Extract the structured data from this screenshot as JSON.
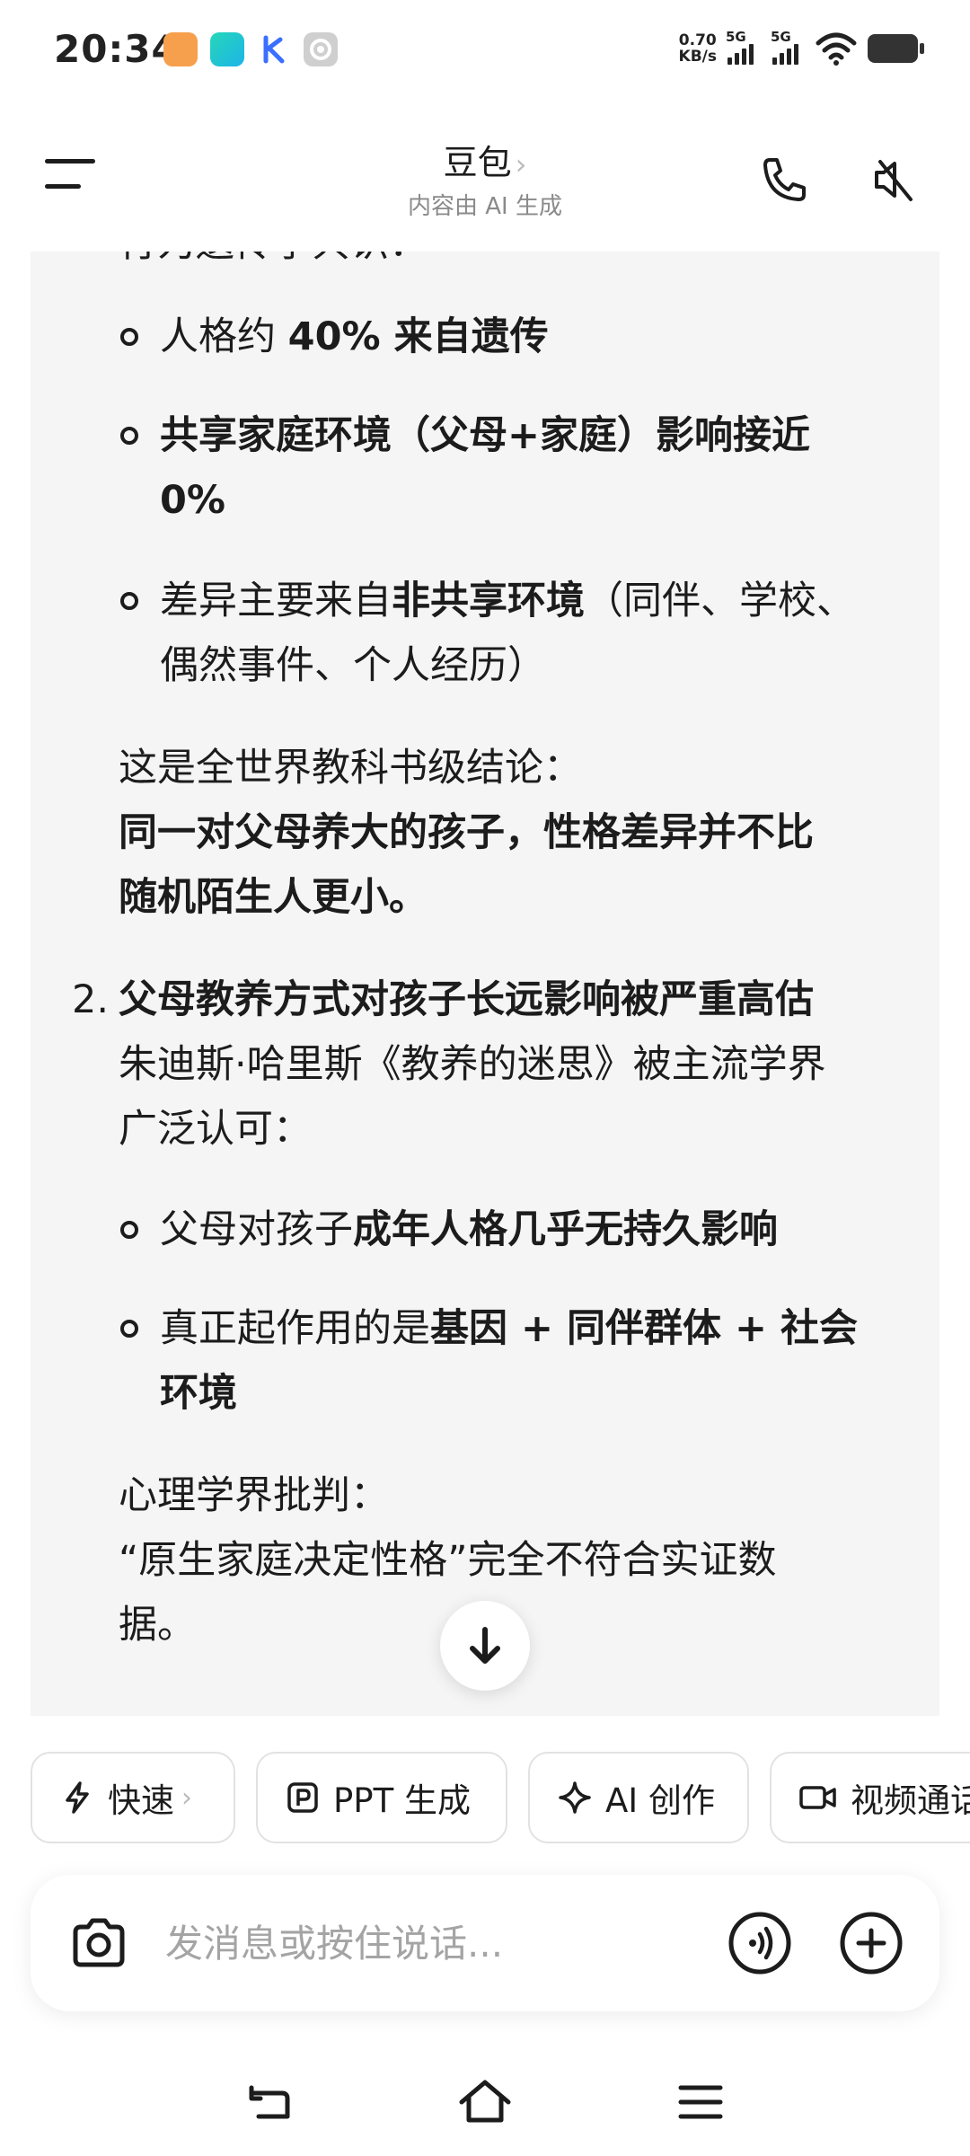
{
  "status_bar": {
    "time": "20:34",
    "speed_value": "0.70",
    "speed_unit": "KB/s",
    "sim1": "5G",
    "sim2": "5G",
    "notification_icons": [
      "app-icon-orange",
      "app-icon-green",
      "app-icon-k",
      "settings-icon"
    ]
  },
  "header": {
    "title": "豆包",
    "title_chevron": "›",
    "subtitle": "内容由 AI 生成"
  },
  "content": {
    "top_partial": "行为遗传学共识：",
    "bullets1": [
      {
        "pre": "人格约 ",
        "bold": "40% 来自遗传",
        "post": ""
      },
      {
        "pre": "",
        "bold": "共享家庭环境（父母+家庭）影响接近",
        "post": ""
      },
      {
        "pre": "",
        "bold": "0%",
        "post": ""
      },
      {
        "pre": "差异主要来自",
        "bold": "非共享环境",
        "post": "（同伴、学校、"
      },
      {
        "pre": "偶然事件、个人经历）",
        "bold": "",
        "post": ""
      }
    ],
    "conclusion_intro": "这是全世界教科书级结论：",
    "conclusion_bold_1": "同一对父母养大的孩子，性格差异并不比",
    "conclusion_bold_2": "随机陌生人更小。",
    "item2_number": "2.",
    "item2_title": "父母教养方式对孩子长远影响被严重高估",
    "item2_line1": "朱迪斯·哈里斯《教养的迷思》被主流学界",
    "item2_line2": "广泛认可：",
    "bullets2": [
      {
        "pre": "父母对孩子",
        "bold": "成年人格几乎无持久影响",
        "post": ""
      },
      {
        "pre": "真正起作用的是",
        "bold": "基因 + 同伴群体 + 社会",
        "post": ""
      },
      {
        "pre": "",
        "bold": "环境",
        "post": ""
      }
    ],
    "critique_intro": "心理学界批判：",
    "critique_line1": "“原生家庭决定性格”完全不符合实证数",
    "critique_line2": "据。"
  },
  "chips": [
    {
      "label": "快速",
      "icon": "lightning-icon",
      "chevron": "›"
    },
    {
      "label": "PPT 生成",
      "icon": "ppt-icon"
    },
    {
      "label": "AI 创作",
      "icon": "sparkle-icon"
    },
    {
      "label": "视频通话",
      "icon": "video-camera-icon"
    }
  ],
  "input": {
    "placeholder": "发消息或按住说话..."
  },
  "colors": {
    "text": "#1c1c1c",
    "muted": "#8a8a8a",
    "card_bg": "#f5f5f5",
    "chip_border": "#e2e2e2"
  }
}
